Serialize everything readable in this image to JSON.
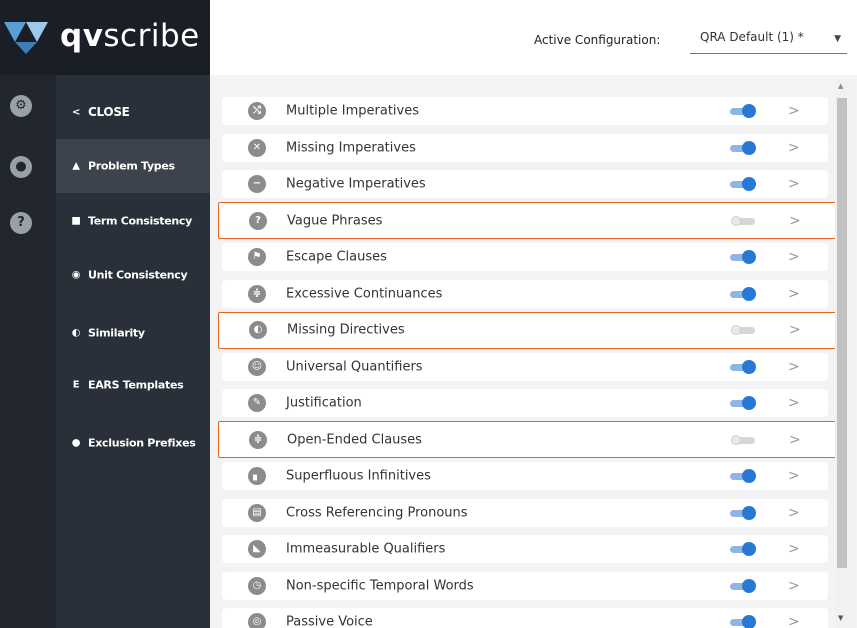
{
  "brand": {
    "bold": "qv",
    "rest": "scribe"
  },
  "header": {
    "config_label": "Active Configuration:",
    "config_value": "QRA Default (1) *",
    "caret": "▼"
  },
  "rail": [
    {
      "name": "settings",
      "glyph": "⚙"
    },
    {
      "name": "user",
      "glyph": "●"
    },
    {
      "name": "help",
      "glyph": "?"
    }
  ],
  "menu": {
    "close_label": "CLOSE",
    "close_glyph": "<",
    "items": [
      {
        "label": "Problem Types",
        "glyph": "▲",
        "active": true
      },
      {
        "label": "Term Consistency",
        "glyph": "■",
        "active": false
      },
      {
        "label": "Unit Consistency",
        "glyph": "◉",
        "active": false
      },
      {
        "label": "Similarity",
        "glyph": "◐",
        "active": false
      },
      {
        "label": "EARS Templates",
        "glyph": "E",
        "active": false
      },
      {
        "label": "Exclusion Prefixes",
        "glyph": "●",
        "active": false
      }
    ]
  },
  "problems": [
    {
      "label": "Multiple Imperatives",
      "enabled": true,
      "highlighted": false,
      "glyph": "⤭"
    },
    {
      "label": "Missing Imperatives",
      "enabled": true,
      "highlighted": false,
      "glyph": "✕"
    },
    {
      "label": "Negative Imperatives",
      "enabled": true,
      "highlighted": false,
      "glyph": "−"
    },
    {
      "label": "Vague Phrases",
      "enabled": false,
      "highlighted": true,
      "glyph": "?"
    },
    {
      "label": "Escape Clauses",
      "enabled": true,
      "highlighted": false,
      "glyph": "⚑"
    },
    {
      "label": "Excessive Continuances",
      "enabled": true,
      "highlighted": false,
      "glyph": "≑"
    },
    {
      "label": "Missing Directives",
      "enabled": false,
      "highlighted": true,
      "glyph": "◐"
    },
    {
      "label": "Universal Quantifiers",
      "enabled": true,
      "highlighted": false,
      "glyph": "☺"
    },
    {
      "label": "Justification",
      "enabled": true,
      "highlighted": false,
      "glyph": "✎"
    },
    {
      "label": "Open-Ended Clauses",
      "enabled": false,
      "highlighted": true,
      "glyph": "≑"
    },
    {
      "label": "Superfluous Infinitives",
      "enabled": true,
      "highlighted": false,
      "glyph": "▖"
    },
    {
      "label": "Cross Referencing Pronouns",
      "enabled": true,
      "highlighted": false,
      "glyph": "▤"
    },
    {
      "label": "Immeasurable Qualifiers",
      "enabled": true,
      "highlighted": false,
      "glyph": "◣"
    },
    {
      "label": "Non-specific Temporal Words",
      "enabled": true,
      "highlighted": false,
      "glyph": "◷"
    },
    {
      "label": "Passive Voice",
      "enabled": true,
      "highlighted": false,
      "glyph": "◎"
    }
  ],
  "scroll": {
    "up": "▲",
    "down": "▼"
  }
}
